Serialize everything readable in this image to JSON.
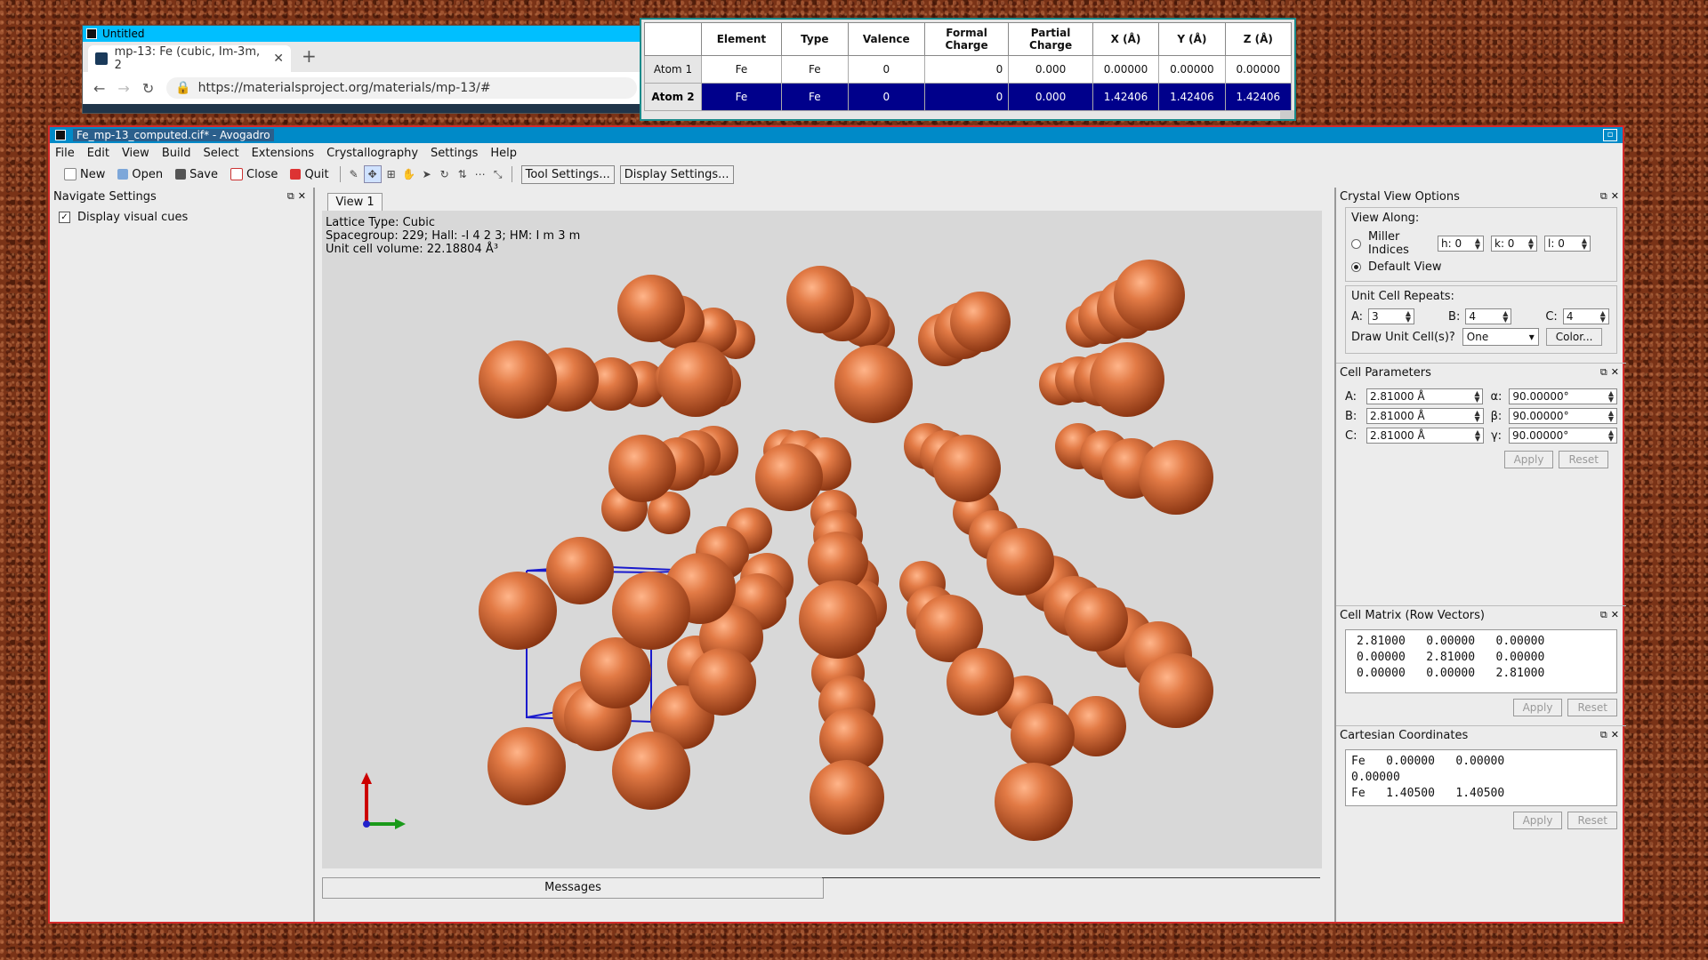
{
  "browser": {
    "window_title": "Untitled",
    "tab_title": "mp-13: Fe (cubic, Im-3m, 2",
    "url": "https://materialsproject.org/materials/mp-13/#"
  },
  "atom_table": {
    "headers": [
      "Element",
      "Type",
      "Valence",
      "Formal Charge",
      "Partial Charge",
      "X (Å)",
      "Y (Å)",
      "Z (Å)"
    ],
    "rows": [
      {
        "label": "Atom 1",
        "element": "Fe",
        "type": "Fe",
        "valence": "0",
        "formal": "0",
        "partial": "0.000",
        "x": "0.00000",
        "y": "0.00000",
        "z": "0.00000"
      },
      {
        "label": "Atom 2",
        "element": "Fe",
        "type": "Fe",
        "valence": "0",
        "formal": "0",
        "partial": "0.000",
        "x": "1.42406",
        "y": "1.42406",
        "z": "1.42406"
      }
    ]
  },
  "avogadro": {
    "window_title": "Fe_mp-13_computed.cif* - Avogadro",
    "menu": [
      "File",
      "Edit",
      "View",
      "Build",
      "Select",
      "Extensions",
      "Crystallography",
      "Settings",
      "Help"
    ],
    "toolbar": {
      "new": "New",
      "open": "Open",
      "save": "Save",
      "close": "Close",
      "quit": "Quit",
      "tool_settings": "Tool Settings...",
      "display_settings": "Display Settings..."
    },
    "left_panel": {
      "title": "Navigate Settings",
      "checkbox_label": "Display visual cues",
      "checked": true
    },
    "view_tab": "View 1",
    "overlay": {
      "line1": "Lattice Type: Cubic",
      "line2": "Spacegroup: 229; Hall: -I 4 2 3; HM: I m 3 m",
      "line3": "Unit cell volume: 22.18804 Å³"
    },
    "messages_tab": "Messages",
    "crystal_view": {
      "title": "Crystal View Options",
      "view_along": "View Along:",
      "miller": "Miller Indices",
      "h": "h: 0",
      "k": "k: 0",
      "l": "l: 0",
      "default_view": "Default View",
      "repeats_title": "Unit Cell Repeats:",
      "a_label": "A:",
      "a_value": "3",
      "b_label": "B:",
      "b_value": "4",
      "c_label": "C:",
      "c_value": "4",
      "draw_label": "Draw Unit Cell(s)?",
      "draw_value": "One",
      "color_btn": "Color..."
    },
    "cell_params": {
      "title": "Cell Parameters",
      "a": "2.81000 Å",
      "b": "2.81000 Å",
      "c": "2.81000 Å",
      "alpha": "90.00000°",
      "beta": "90.00000°",
      "gamma": "90.00000°",
      "apply": "Apply",
      "reset": "Reset"
    },
    "cell_matrix": {
      "title": "Cell Matrix (Row Vectors)",
      "text": "2.81000   0.00000   0.00000\n0.00000   2.81000   0.00000\n0.00000   0.00000   2.81000",
      "apply": "Apply",
      "reset": "Reset"
    },
    "cartesian": {
      "title": "Cartesian Coordinates",
      "text": "Fe   0.00000   0.00000\n0.00000\nFe   1.40500   1.40500",
      "apply": "Apply",
      "reset": "Reset"
    }
  },
  "colors": {
    "atom": "#d86a38",
    "cell_lines": "#1a1acc",
    "selection": "#00008b"
  }
}
